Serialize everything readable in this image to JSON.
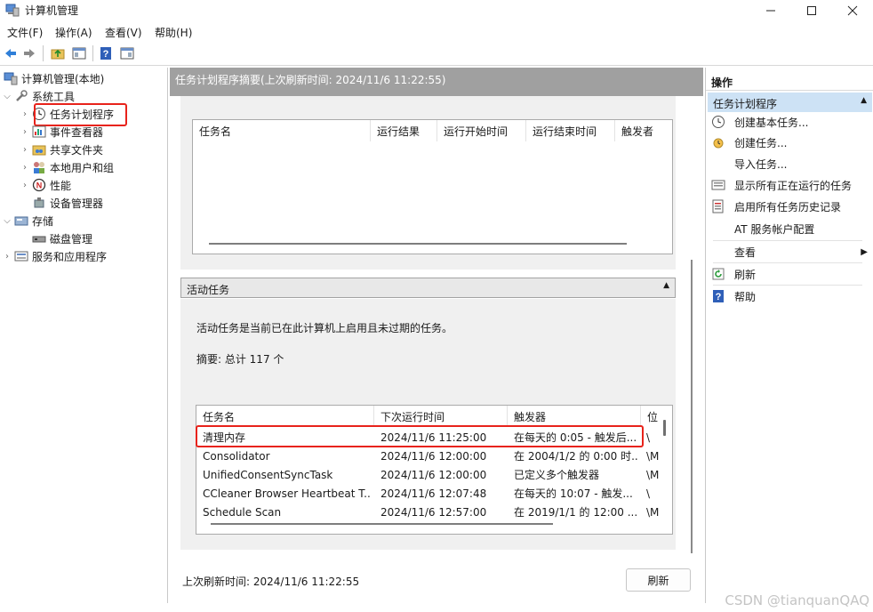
{
  "window": {
    "title": "计算机管理"
  },
  "menu": [
    "文件(F)",
    "操作(A)",
    "查看(V)",
    "帮助(H)"
  ],
  "tree": {
    "root": "计算机管理(本地)",
    "system_tools": "系统工具",
    "task_scheduler": "任务计划程序",
    "event_viewer": "事件查看器",
    "shared_folders": "共享文件夹",
    "local_users": "本地用户和组",
    "performance": "性能",
    "device_manager": "设备管理器",
    "storage": "存储",
    "disk_management": "磁盘管理",
    "services_apps": "服务和应用程序"
  },
  "center": {
    "header": "任务计划程序摘要(上次刷新时间: 2024/11/6 11:22:55)",
    "status_grid_columns": [
      "任务名",
      "运行结果",
      "运行开始时间",
      "运行结束时间",
      "触发者"
    ],
    "active_tasks_title": "活动任务",
    "active_desc": "活动任务是当前已在此计算机上启用且未过期的任务。",
    "summary": "摘要: 总计 117 个",
    "active_columns": [
      "任务名",
      "下次运行时间",
      "触发器",
      "位"
    ],
    "active_rows": [
      {
        "name": "清理内存",
        "next": "2024/11/6 11:25:00",
        "trigger": "在每天的 0:05 - 触发后...",
        "loc": "\\"
      },
      {
        "name": "Consolidator",
        "next": "2024/11/6 12:00:00",
        "trigger": "在 2004/1/2 的 0:00 时...",
        "loc": "\\M"
      },
      {
        "name": "UnifiedConsentSyncTask",
        "next": "2024/11/6 12:00:00",
        "trigger": "已定义多个触发器",
        "loc": "\\M"
      },
      {
        "name": "CCleaner Browser Heartbeat T...",
        "next": "2024/11/6 12:07:48",
        "trigger": "在每天的 10:07 - 触发...",
        "loc": "\\"
      },
      {
        "name": "Schedule Scan",
        "next": "2024/11/6 12:57:00",
        "trigger": "在 2019/1/1 的 12:00 ...",
        "loc": "\\M"
      }
    ],
    "last_refresh": "上次刷新时间: 2024/11/6 11:22:55",
    "refresh_button": "刷新"
  },
  "actions": {
    "title": "操作",
    "group": "任务计划程序",
    "items": [
      "创建基本任务...",
      "创建任务...",
      "导入任务...",
      "显示所有正在运行的任务",
      "启用所有任务历史记录",
      "AT 服务帐户配置",
      "查看",
      "刷新",
      "帮助"
    ]
  },
  "watermark": "CSDN @tianquanQAQ",
  "colors": {
    "highlight_red": "#e8231b",
    "center_header_gray": "#a0a0a0",
    "action_group_blue": "#cde2f5"
  }
}
